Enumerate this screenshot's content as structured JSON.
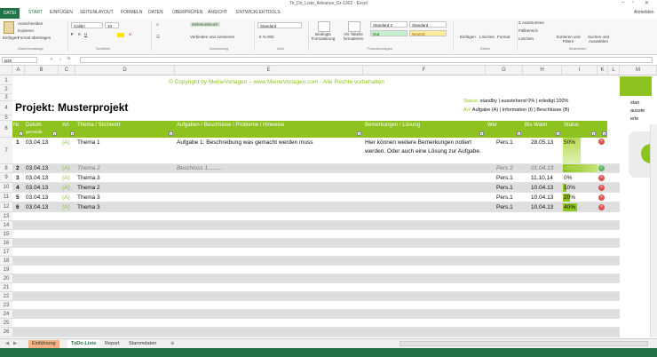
{
  "window": {
    "title": "To_Do_Liste_Advance_Gr-1302 - Excel",
    "user": "Anmelden"
  },
  "ribbon": {
    "tabs": [
      "DATEI",
      "START",
      "EINFÜGEN",
      "SEITENLAYOUT",
      "FORMELN",
      "DATEN",
      "ÜBERPRÜFEN",
      "ANSICHT",
      "ENTWICKLERTOOLS"
    ],
    "paste": "Einfügen",
    "cut": "Ausschneiden",
    "copy": "Kopieren",
    "format_painter": "Format übertragen",
    "clipboard_group": "Zwischenablage",
    "font_name": "Calibri",
    "font_size": "10",
    "font_group": "Schriftart",
    "wrap_text": "Zeilenumbruch",
    "merge": "Verbinden und zentrieren",
    "align_group": "Ausrichtung",
    "number_format": "Standard",
    "number_group": "Zahl",
    "cond_format": "Bedingte Formatierung",
    "as_table": "Als Tabelle formatieren",
    "style1": "Standard 2",
    "style2": "Standard",
    "style3": "Gut",
    "style4": "Neutral",
    "styles_group": "Formatvorlagen",
    "insert": "Einfügen",
    "delete": "Löschen",
    "format": "Format",
    "cells_group": "Zellen",
    "autosum": "AutoSumme",
    "fill": "Füllbereich",
    "clear": "Löschen",
    "sort": "Sortieren und Filtern",
    "find": "Suchen und Auswählen",
    "edit_group": "Bearbeiten"
  },
  "formula_bar": {
    "name_box": "B28",
    "fx": "fx"
  },
  "columns": [
    "A",
    "B",
    "C",
    "D",
    "E",
    "F",
    "G",
    "H",
    "I",
    "K",
    "L",
    "M"
  ],
  "rows": [
    "1",
    "2",
    "3",
    "4",
    "5",
    "6",
    "7",
    "8",
    "9",
    "10",
    "11",
    "12",
    "13",
    "14",
    "15",
    "16",
    "17",
    "18",
    "19",
    "20",
    "21",
    "22",
    "23",
    "24",
    "25",
    "26"
  ],
  "sheet": {
    "copyright": "© Copyright by MeineVorlagen – www.MeineVorlagen.com - Alle Rechte vorbehalten",
    "project_title": "Projekt: Musterprojekt",
    "legend_status_label": "Status:",
    "legend_status_values": "standby | ausstehend 0% | erledigt 100%",
    "legend_art_label": "Art:",
    "legend_art_values": "Aufgabe (A) | Information (I) | Beschlüsse (B)",
    "headers": [
      "Nr.",
      "Datum",
      "Art",
      "Thema / Stichwort",
      "Aufgaben / Beschlüsse / Probleme / Hinweise",
      "Bemerkungen / Lösung",
      "Wer",
      "Bis Wann",
      "Status"
    ],
    "datum_sub": "gemeldet",
    "entries": [
      {
        "nr": "1",
        "datum": "03.04.13",
        "art": "(A)",
        "thema": "Thema 1",
        "aufgabe": "Aufgabe 1:  Beschreibung  was gemacht werden muss",
        "bemerkung": "Hier können weitere Bemerkungen notiert werden. Oder auch eine Lösung zur Aufgabe.",
        "wer": "Pers.1",
        "bis": "28.05.13",
        "status": "50%"
      },
      {
        "nr": "2",
        "datum": "03.04.13",
        "art": "(A)",
        "thema": "Thema 2",
        "aufgabe": "Beschluss 1.........",
        "bemerkung": "",
        "wer": "Pers 2",
        "bis": "01.04.13",
        "status": "100%"
      },
      {
        "nr": "3",
        "datum": "03.04.13",
        "art": "(A)",
        "thema": "Thema 3",
        "aufgabe": "",
        "bemerkung": "",
        "wer": "Pers.1",
        "bis": "11.10.14",
        "status": "0%"
      },
      {
        "nr": "4",
        "datum": "03.04.13",
        "art": "(A)",
        "thema": "Thema 2",
        "aufgabe": "",
        "bemerkung": "",
        "wer": "Pers.1",
        "bis": "10.04.13",
        "status": "10%"
      },
      {
        "nr": "5",
        "datum": "03.04.13",
        "art": "(A)",
        "thema": "Thema 3",
        "aufgabe": "",
        "bemerkung": "",
        "wer": "Pers.1",
        "bis": "10.04.13",
        "status": "20%"
      },
      {
        "nr": "6",
        "datum": "03.04.13",
        "art": "(A)",
        "thema": "Thema 3",
        "aufgabe": "",
        "bemerkung": "",
        "wer": "Pers.1",
        "bis": "10.04.13",
        "status": "40%"
      }
    ],
    "side_text": [
      "stan",
      "ausste",
      "erle"
    ]
  },
  "sheet_tabs": [
    "Einführung",
    "ToDo-Liste",
    "Report",
    "Stammdaten"
  ],
  "colors": {
    "excel_green": "#217346",
    "lime": "#8dc21f",
    "red": "#d9534f"
  }
}
